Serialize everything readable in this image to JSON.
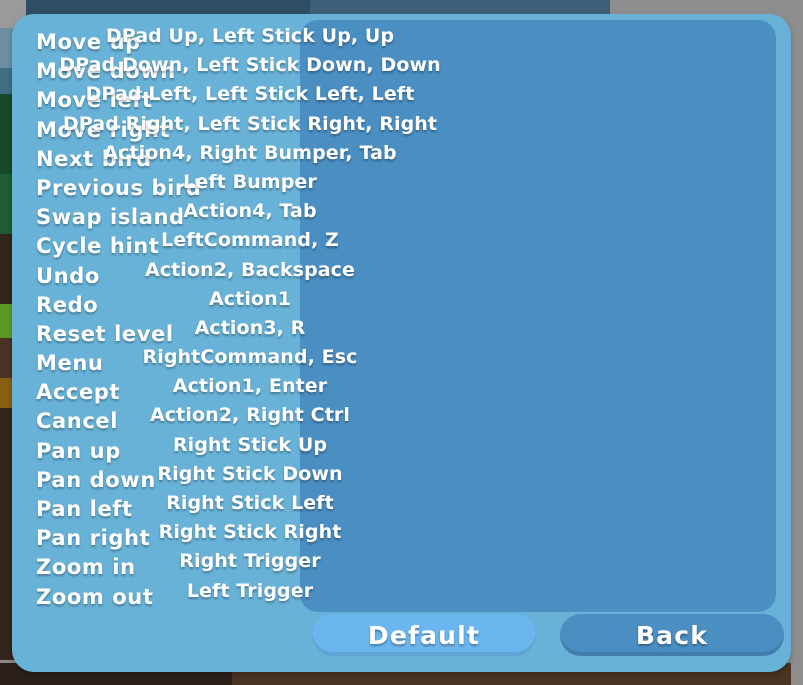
{
  "screen": {
    "name": "controls-bindings-menu",
    "panel_color": "#68b2d8",
    "bindings_panel_color": "#4a8ec2"
  },
  "bindings_table": {
    "rows": [
      {
        "action": "Move up",
        "binding": "DPad Up, Left Stick Up, Up"
      },
      {
        "action": "Move down",
        "binding": "DPad Down, Left Stick Down, Down"
      },
      {
        "action": "Move left",
        "binding": "DPad Left, Left Stick Left, Left"
      },
      {
        "action": "Move right",
        "binding": "DPad Right, Left Stick Right, Right"
      },
      {
        "action": "Next bird",
        "binding": "Action4, Right Bumper, Tab"
      },
      {
        "action": "Previous bird",
        "binding": "Left Bumper"
      },
      {
        "action": "Swap island",
        "binding": "Action4, Tab"
      },
      {
        "action": "Cycle hint",
        "binding": "LeftCommand, Z"
      },
      {
        "action": "Undo",
        "binding": "Action2, Backspace"
      },
      {
        "action": "Redo",
        "binding": "Action1"
      },
      {
        "action": "Reset level",
        "binding": "Action3, R"
      },
      {
        "action": "Menu",
        "binding": "RightCommand, Esc"
      },
      {
        "action": "Accept",
        "binding": "Action1, Enter"
      },
      {
        "action": "Cancel",
        "binding": "Action2, Right Ctrl"
      },
      {
        "action": "Pan up",
        "binding": "Right Stick Up"
      },
      {
        "action": "Pan down",
        "binding": "Right Stick Down"
      },
      {
        "action": "Pan left",
        "binding": "Right Stick Left"
      },
      {
        "action": "Pan right",
        "binding": "Right Stick Right"
      },
      {
        "action": "Zoom in",
        "binding": "Right Trigger"
      },
      {
        "action": "Zoom out",
        "binding": "Left Trigger"
      }
    ]
  },
  "footer": {
    "default_label": "Default",
    "back_label": "Back",
    "default_color": "#6cb6ef",
    "back_color": "#4a8ec2"
  }
}
